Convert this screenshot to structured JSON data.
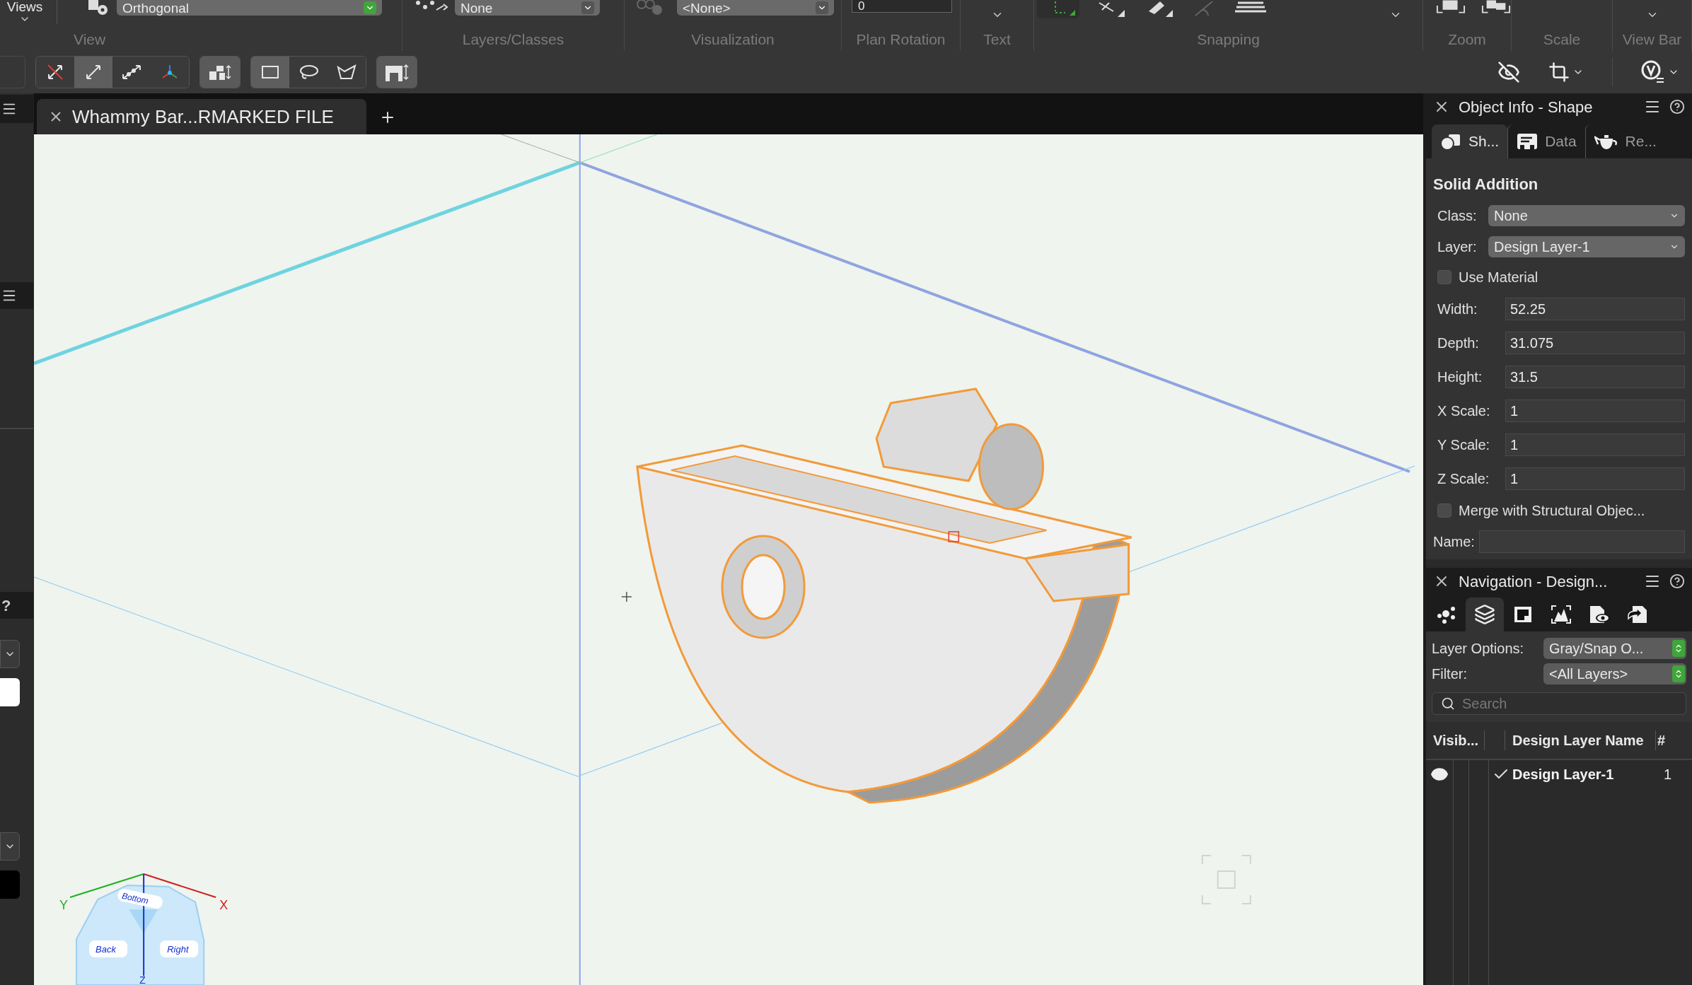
{
  "toolbar": {
    "views_label": "Views",
    "dropdowns": [
      {
        "value": "Orthogonal",
        "confirmed": true
      },
      {
        "value": "None",
        "confirmed": false
      },
      {
        "value": "<None>",
        "confirmed": false
      }
    ],
    "plan_rotation": {
      "value": "0"
    },
    "groups": [
      "View",
      "Layers/Classes",
      "Visualization",
      "Plan Rotation",
      "Text",
      "Snapping",
      "Zoom",
      "Scale",
      "View Bar"
    ],
    "tool_groups": [
      [
        {
          "kind": "snap-off",
          "selected": false
        },
        {
          "kind": "snap-pair",
          "selected": true
        },
        {
          "kind": "snap-multi",
          "selected": false
        },
        {
          "kind": "axes",
          "selected": false
        }
      ],
      [
        {
          "kind": "align",
          "selected": false
        }
      ],
      [
        {
          "kind": "rect",
          "selected": true
        },
        {
          "kind": "lasso",
          "selected": false
        },
        {
          "kind": "poly",
          "selected": false
        }
      ],
      [
        {
          "kind": "wall",
          "selected": false
        }
      ]
    ]
  },
  "document_tab": {
    "title": "Whammy Bar...RMARKED FILE"
  },
  "view_cube": {
    "axes": [
      "Y",
      "X",
      "Z"
    ],
    "faces": [
      "Bottom",
      "Back",
      "Right"
    ]
  },
  "left_strip": {
    "help": "?"
  },
  "object_info": {
    "title": "Object Info - Shape",
    "tabs": [
      {
        "label": "Sh...",
        "selected": true
      },
      {
        "label": "Data",
        "selected": false
      },
      {
        "label": "Re...",
        "selected": false
      }
    ],
    "heading": "Solid Addition",
    "selects": [
      {
        "label": "Class:",
        "value": "None"
      },
      {
        "label": "Layer:",
        "value": "Design Layer-1"
      }
    ],
    "use_material": {
      "label": "Use Material",
      "checked": false
    },
    "fields": [
      {
        "label": "Width:",
        "value": "52.25"
      },
      {
        "label": "Depth:",
        "value": "31.075"
      },
      {
        "label": "Height:",
        "value": "31.5"
      },
      {
        "label": "X Scale:",
        "value": "1"
      },
      {
        "label": "Y Scale:",
        "value": "1"
      },
      {
        "label": "Z Scale:",
        "value": "1"
      }
    ],
    "merge": {
      "label": "Merge with Structural Objec...",
      "checked": false
    },
    "name": {
      "label": "Name:"
    }
  },
  "navigation": {
    "title": "Navigation - Design...",
    "tabs": [
      {
        "kind": "graph",
        "selected": false
      },
      {
        "kind": "layers",
        "selected": true
      },
      {
        "kind": "sheet",
        "selected": false
      },
      {
        "kind": "views",
        "selected": false
      },
      {
        "kind": "viewports",
        "selected": false
      },
      {
        "kind": "references",
        "selected": false
      }
    ],
    "layer_options": {
      "label": "Layer Options:",
      "value": "Gray/Snap O..."
    },
    "filter": {
      "label": "Filter:",
      "value": "<All Layers>"
    },
    "search": {
      "placeholder": "Search"
    },
    "columns": [
      "Visib...",
      "Design Layer Name",
      "#"
    ],
    "rows": [
      {
        "name": "Design Layer-1",
        "visible": true,
        "active": true,
        "number": "1"
      }
    ]
  }
}
